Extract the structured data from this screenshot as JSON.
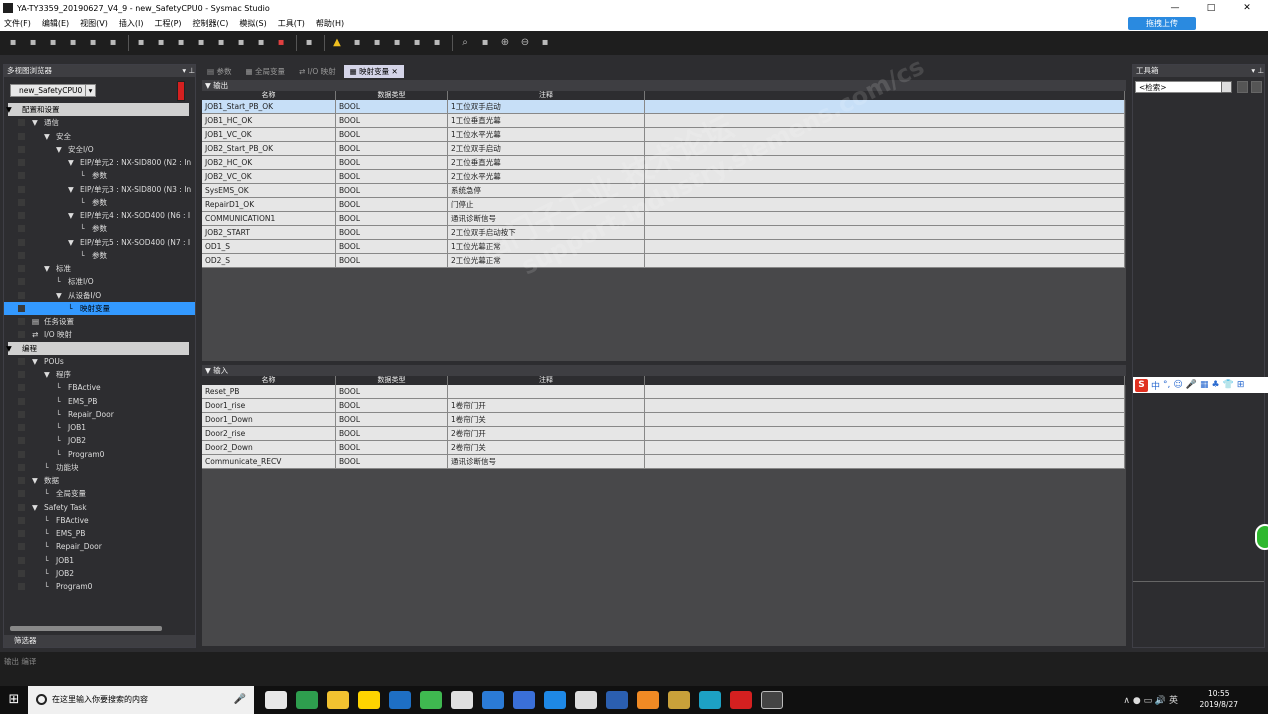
{
  "window": {
    "title": "YA-TY3359_20190627_V4_9 - new_SafetyCPU0 - Sysmac Studio",
    "controls": [
      "—",
      "□",
      "✕"
    ]
  },
  "menu": {
    "items": [
      "文件(F)",
      "编辑(E)",
      "视图(V)",
      "插入(I)",
      "工程(P)",
      "控制器(C)",
      "模拟(S)",
      "工具(T)",
      "帮助(H)"
    ],
    "upload_label": "拖拽上传"
  },
  "toolbar": {
    "icons": [
      "cut-icon",
      "copy-icon",
      "paste-icon",
      "delete-icon",
      "undo-icon",
      "redo-icon",
      "build-icon",
      "print-icon",
      "online-icon",
      "offline-icon",
      "monitor-icon",
      "sync-icon",
      "transfer-icon",
      "stop-icon",
      "cursor-icon",
      "warning-icon",
      "run-icon",
      "step-icon",
      "pause-icon",
      "reset-icon",
      "compare-icon",
      "search-icon",
      "zoom-fit-icon",
      "zoom-in-icon",
      "zoom-out-icon",
      "zoom-reset-icon"
    ]
  },
  "left_panel": {
    "title": "多视图浏览器",
    "device": "new_SafetyCPU0",
    "footer": "筛选器",
    "tree": [
      {
        "label": "配置和设置",
        "indent": 0,
        "type": "header"
      },
      {
        "label": "通信",
        "indent": 1,
        "prefix": "▼ ⌗ "
      },
      {
        "label": "安全",
        "indent": 2,
        "prefix": "▼ ▣ "
      },
      {
        "label": "安全I/O",
        "indent": 3,
        "prefix": "▼ ▥ "
      },
      {
        "label": "EIP/单元2 : NX-SID800 (N2 : In",
        "indent": 4,
        "prefix": "▼ ▤ "
      },
      {
        "label": "参数",
        "indent": 5,
        "prefix": "└ ▤ "
      },
      {
        "label": "EIP/单元3 : NX-SID800 (N3 : In",
        "indent": 4,
        "prefix": "▼ ▤ "
      },
      {
        "label": "参数",
        "indent": 5,
        "prefix": "└ ▤ "
      },
      {
        "label": "EIP/单元4 : NX-SOD400 (N6 : I",
        "indent": 4,
        "prefix": "▼ ▤ "
      },
      {
        "label": "参数",
        "indent": 5,
        "prefix": "└ ▤ "
      },
      {
        "label": "EIP/单元5 : NX-SOD400 (N7 : I",
        "indent": 4,
        "prefix": "▼ ▤ "
      },
      {
        "label": "参数",
        "indent": 5,
        "prefix": "└ ▤ "
      },
      {
        "label": "标准",
        "indent": 2,
        "prefix": "▼ ▣ "
      },
      {
        "label": "标准I/O",
        "indent": 3,
        "prefix": "└ ▣ "
      },
      {
        "label": "从设备I/O",
        "indent": 3,
        "prefix": "▼ ⇄ "
      },
      {
        "label": "映射变量",
        "indent": 4,
        "prefix": "└ ▦ ",
        "selected": true
      },
      {
        "label": "任务设置",
        "indent": 1,
        "prefix": "▤ "
      },
      {
        "label": "I/O 映射",
        "indent": 1,
        "prefix": "⇄ "
      },
      {
        "label": "编程",
        "indent": 0,
        "type": "header"
      },
      {
        "label": "POUs",
        "indent": 1,
        "prefix": "▼ ▤ "
      },
      {
        "label": "程序",
        "indent": 2,
        "prefix": "▼ ▥ "
      },
      {
        "label": "FBActive",
        "indent": 3,
        "prefix": "└ ▤ "
      },
      {
        "label": "EMS_PB",
        "indent": 3,
        "prefix": "└ ▤ "
      },
      {
        "label": "Repair_Door",
        "indent": 3,
        "prefix": "└ ▤ "
      },
      {
        "label": "JOB1",
        "indent": 3,
        "prefix": "└ ▤ "
      },
      {
        "label": "JOB2",
        "indent": 3,
        "prefix": "└ ▤ "
      },
      {
        "label": "Program0",
        "indent": 3,
        "prefix": "└ ▤ "
      },
      {
        "label": "功能块",
        "indent": 2,
        "prefix": "└ ▤ "
      },
      {
        "label": "数据",
        "indent": 1,
        "prefix": "▼ ▥ "
      },
      {
        "label": "全局变量",
        "indent": 2,
        "prefix": "└ ▤ "
      },
      {
        "label": "Safety Task",
        "indent": 1,
        "prefix": "▼ ▥ "
      },
      {
        "label": "FBActive",
        "indent": 2,
        "prefix": "└ ▤ "
      },
      {
        "label": "EMS_PB",
        "indent": 2,
        "prefix": "└ ▤ "
      },
      {
        "label": "Repair_Door",
        "indent": 2,
        "prefix": "└ ▤ "
      },
      {
        "label": "JOB1",
        "indent": 2,
        "prefix": "└ ▤ "
      },
      {
        "label": "JOB2",
        "indent": 2,
        "prefix": "└ ▤ "
      },
      {
        "label": "Program0",
        "indent": 2,
        "prefix": "└ ▤ "
      }
    ]
  },
  "tabs": [
    {
      "label": "▤ 参数",
      "active": false
    },
    {
      "label": "▦ 全局变量",
      "active": false
    },
    {
      "label": "⇄ I/O 映射",
      "active": false
    },
    {
      "label": "▦ 映射变量 ✕",
      "active": true
    }
  ],
  "columns": [
    "名称",
    "数据类型",
    "注释"
  ],
  "output_section": {
    "title": "▼ 输出",
    "rows": [
      [
        "JOB1_Start_PB_OK",
        "BOOL",
        "1工位双手启动"
      ],
      [
        "JOB1_HC_OK",
        "BOOL",
        "1工位垂直光幕"
      ],
      [
        "JOB1_VC_OK",
        "BOOL",
        "1工位水平光幕"
      ],
      [
        "JOB2_Start_PB_OK",
        "BOOL",
        "2工位双手启动"
      ],
      [
        "JOB2_HC_OK",
        "BOOL",
        "2工位垂直光幕"
      ],
      [
        "JOB2_VC_OK",
        "BOOL",
        "2工位水平光幕"
      ],
      [
        "SysEMS_OK",
        "BOOL",
        "系统急停"
      ],
      [
        "RepairD1_OK",
        "BOOL",
        "门停止"
      ],
      [
        "COMMUNICATION1",
        "BOOL",
        "通讯诊断信号"
      ],
      [
        "JOB2_START",
        "BOOL",
        "2工位双手启动按下"
      ],
      [
        "OD1_S",
        "BOOL",
        "1工位光幕正常"
      ],
      [
        "OD2_S",
        "BOOL",
        "2工位光幕正常"
      ]
    ]
  },
  "input_section": {
    "title": "▼ 输入",
    "rows": [
      [
        "Reset_PB",
        "BOOL",
        ""
      ],
      [
        "Door1_rise",
        "BOOL",
        "1卷帘门开"
      ],
      [
        "Door1_Down",
        "BOOL",
        "1卷帘门关"
      ],
      [
        "Door2_rise",
        "BOOL",
        "2卷帘门开"
      ],
      [
        "Door2_Down",
        "BOOL",
        "2卷帘门关"
      ],
      [
        "Communicate_RECV",
        "BOOL",
        "通讯诊断信号"
      ]
    ]
  },
  "right_panel": {
    "title": "工具箱",
    "search": "<检索>"
  },
  "ime": {
    "logo": "S",
    "items": [
      "中",
      "°,",
      "☺",
      "🎤",
      "▦",
      "♣",
      "👕",
      "⊞"
    ]
  },
  "output_bar": {
    "tabs": "输出  编译"
  },
  "watermark": {
    "line1": "西门子工业 技术论坛",
    "line2": "support.industry.siemens.com/cs"
  },
  "taskbar": {
    "search_placeholder": "在这里输入你要搜索的内容",
    "time": "10:55",
    "date": "2019/8/27",
    "tray": "∧ ● ▭ 🔊 英",
    "app_colors": [
      "#e8e8e8",
      "#2e9e4e",
      "#f2c230",
      "#ffd400",
      "#1e6fc4",
      "#3fb950",
      "#e0e0e0",
      "#2b7bd6",
      "#3a6fd8",
      "#1e88e5",
      "#ddd",
      "#2b5fb0",
      "#f08a24",
      "#c9a13a",
      "#1da1c4",
      "#d42020",
      "#444"
    ]
  }
}
